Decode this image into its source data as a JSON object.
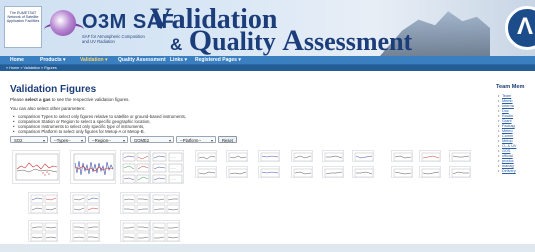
{
  "banner": {
    "eumetsat_text": "The EUMETSAT Network of Satellite Application Facilities",
    "o3m_title": "O3M SAF",
    "o3m_subtitle": "SAF for Atmospheric Composition and UV Radiation",
    "vqa_l1_big": "V",
    "vqa_l1_rest": "alidation",
    "vqa_amp": "&",
    "vqa_l2_q": "Q",
    "vqa_l2_mid": "uality ",
    "vqa_l2_a": "A",
    "vqa_l2_rest": "ssessment"
  },
  "nav": {
    "items": [
      {
        "label": "Home"
      },
      {
        "label": "Products ▾"
      },
      {
        "label": "Validation ▾"
      },
      {
        "label": "Quality Assessment"
      },
      {
        "label": "Links ▾"
      },
      {
        "label": "Registered Pages ▾"
      }
    ]
  },
  "breadcrumb": "» Home » Validation » Figures",
  "main": {
    "title": "Validation Figures",
    "intro_pre": "Please ",
    "intro_bold": "select a gas",
    "intro_post": " to see the respective validation figures.",
    "intro2": "You can also select other parameters:",
    "bullets": [
      "comparison Types to select only figures relative to satellite or ground-based instruments,",
      "comparison Station or Region to select a specific geographic location,",
      "comparison Instruments to select only specific type of instruments,",
      "comparison Platform to select only figures for Metop-A or Metop-B."
    ],
    "filters": {
      "gas": "SO2",
      "types": "--Types--",
      "region": "--Region--",
      "instrument": "GOME2",
      "platform": "--Platform--",
      "reset": "Reset"
    }
  },
  "sidebar": {
    "title": "Team Mem",
    "links": [
      "Team",
      "Memb",
      "Interna",
      "Doc",
      "Routin",
      "Grant",
      "Packag",
      "Meteo",
      "Comm",
      "Metop",
      "O₃ & UV",
      "GOS",
      "official",
      "produc",
      "manag",
      "Delivery"
    ]
  },
  "colors": {
    "nav_bg": "#3a7fbf",
    "title_blue": "#1b3d7a",
    "link_blue": "#2a5fa8"
  }
}
